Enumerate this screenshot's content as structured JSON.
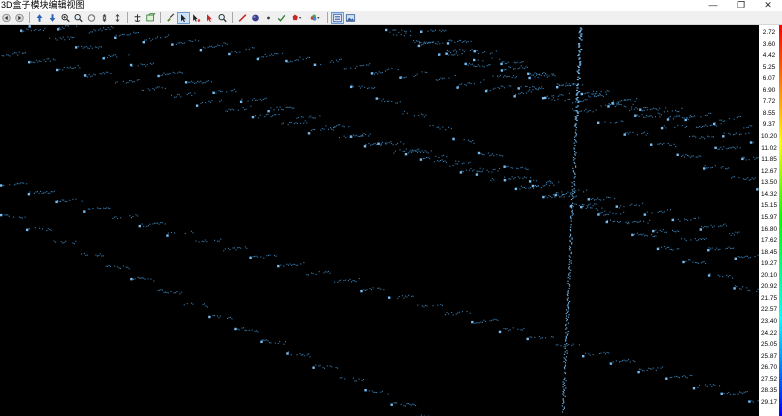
{
  "window": {
    "title": "3D盒子模块编辑视图",
    "controls": {
      "minimize": "—",
      "maximize": "❐",
      "close": "✕"
    }
  },
  "toolbar": {
    "tools": [
      {
        "name": "scroll-left-button",
        "icon": "arrow-left-icon"
      },
      {
        "name": "scroll-right-button",
        "icon": "arrow-right-icon"
      },
      {
        "sep": true
      },
      {
        "name": "move-up-button",
        "icon": "arrow-up-icon"
      },
      {
        "name": "move-down-button",
        "icon": "arrow-down-icon"
      },
      {
        "name": "zoom-in-button",
        "icon": "zoom-in-icon"
      },
      {
        "name": "zoom-button",
        "icon": "magnifier-icon"
      },
      {
        "name": "rotate-button",
        "icon": "rotate-icon"
      },
      {
        "name": "fit-vertical-button",
        "icon": "fit-vertical-icon"
      },
      {
        "name": "fit-height-button",
        "icon": "fit-height-icon"
      },
      {
        "sep": true
      },
      {
        "name": "anchor-button",
        "icon": "anchor-icon"
      },
      {
        "name": "box-view-button",
        "icon": "box-view-icon"
      },
      {
        "sep": true
      },
      {
        "name": "edit-brush-button",
        "icon": "brush-icon"
      },
      {
        "name": "select-pointer-button",
        "icon": "pointer-icon",
        "active": true
      },
      {
        "name": "point-pick-button",
        "icon": "point-pick-icon"
      },
      {
        "name": "red-pointer-button",
        "icon": "red-pointer-icon"
      },
      {
        "name": "search-button",
        "icon": "magnifier-icon"
      },
      {
        "sep": true
      },
      {
        "name": "draw-line-button",
        "icon": "line-icon"
      },
      {
        "name": "sphere-button",
        "icon": "sphere-icon"
      },
      {
        "name": "small-dot-button",
        "icon": "dot-icon"
      },
      {
        "name": "check-button",
        "icon": "check-icon"
      },
      {
        "name": "shape-menu-button",
        "icon": "shape-dropdown-icon"
      },
      {
        "name": "color-menu-button",
        "icon": "color-dropdown-icon"
      },
      {
        "sep": true
      },
      {
        "name": "layers-button",
        "icon": "layers-icon",
        "active": true
      },
      {
        "name": "image-button",
        "icon": "image-icon"
      }
    ]
  },
  "colors": {
    "background": "#000000",
    "points": "#4aa6e8",
    "point_highlight": "#7ec8ff"
  },
  "scale": {
    "labels": [
      "2.72",
      "3.60",
      "4.42",
      "5.25",
      "6.07",
      "6.90",
      "7.72",
      "8.55",
      "9.37",
      "10.20",
      "11.02",
      "11.85",
      "12.67",
      "13.50",
      "14.32",
      "15.15",
      "15.97",
      "16.80",
      "17.62",
      "18.45",
      "19.27",
      "20.10",
      "20.92",
      "21.75",
      "22.57",
      "23.40",
      "24.22",
      "25.05",
      "25.87",
      "26.70",
      "27.52",
      "28.35",
      "29.17"
    ],
    "gradient": [
      "#ff0000",
      "#ffff00",
      "#00ff00",
      "#00ffff",
      "#0000ff"
    ]
  }
}
